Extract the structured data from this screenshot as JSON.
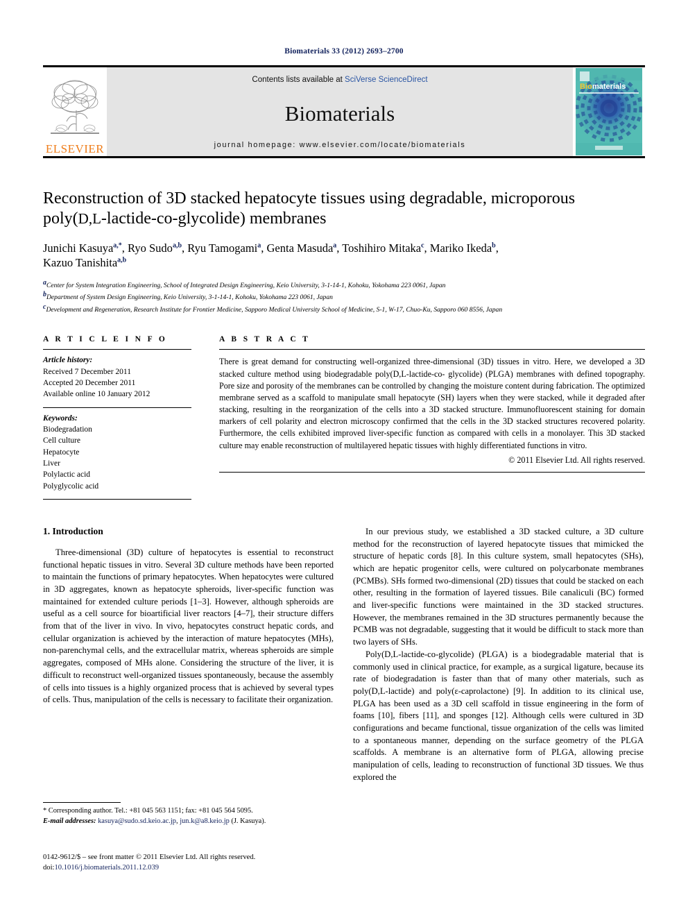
{
  "running_head": "Biomaterials 33 (2012) 2693–2700",
  "masthead": {
    "publisher_wordmark": "ELSEVIER",
    "contents_prefix": "Contents lists available at ",
    "contents_link": "SciVerse ScienceDirect",
    "journal_title": "Biomaterials",
    "homepage": "journal homepage: www.elsevier.com/locate/biomaterials",
    "cover_word_bio": "Bio",
    "cover_word_materials": "materials"
  },
  "article": {
    "title_line1": "Reconstruction of 3D stacked hepatocyte tissues using degradable, microporous",
    "title_line2_pre": "poly(",
    "title_line2_sc": "D,L",
    "title_line2_post": "-lactide-co-glycolide) membranes",
    "authors": [
      {
        "name": "Junichi Kasuya",
        "sup": "a,*"
      },
      {
        "name": "Ryo Sudo",
        "sup": "a,b"
      },
      {
        "name": "Ryu Tamogami",
        "sup": "a"
      },
      {
        "name": "Genta Masuda",
        "sup": "a"
      },
      {
        "name": "Toshihiro Mitaka",
        "sup": "c"
      },
      {
        "name": "Mariko Ikeda",
        "sup": "b"
      },
      {
        "name": "Kazuo Tanishita",
        "sup": "a,b"
      }
    ],
    "affiliations": [
      {
        "mark": "a",
        "text": "Center for System Integration Engineering, School of Integrated Design Engineering, Keio University, 3-1-14-1, Kohoku, Yokohama 223 0061, Japan"
      },
      {
        "mark": "b",
        "text": "Department of System Design Engineering, Keio University, 3-1-14-1, Kohoku, Yokohama 223 0061, Japan"
      },
      {
        "mark": "c",
        "text": "Development and Regeneration, Research Institute for Frontier Medicine, Sapporo Medical University School of Medicine, S-1, W-17, Chuo-Ku, Sapporo 060 8556, Japan"
      }
    ]
  },
  "article_info": {
    "heading": "A R T I C L E   I N F O",
    "history_label": "Article history:",
    "history": [
      "Received 7 December 2011",
      "Accepted 20 December 2011",
      "Available online 10 January 2012"
    ],
    "keywords_label": "Keywords:",
    "keywords": [
      "Biodegradation",
      "Cell culture",
      "Hepatocyte",
      "Liver",
      "Polylactic acid",
      "Polyglycolic acid"
    ]
  },
  "abstract": {
    "heading": "A B S T R A C T",
    "text": "There is great demand for constructing well-organized three-dimensional (3D) tissues in vitro. Here, we developed a 3D stacked culture method using biodegradable poly(D,L-lactide-co- glycolide) (PLGA) membranes with defined topography. Pore size and porosity of the membranes can be controlled by changing the moisture content during fabrication. The optimized membrane served as a scaffold to manipulate small hepatocyte (SH) layers when they were stacked, while it degraded after stacking, resulting in the reorganization of the cells into a 3D stacked structure. Immunofluorescent staining for domain markers of cell polarity and electron microscopy confirmed that the cells in the 3D stacked structures recovered polarity. Furthermore, the cells exhibited improved liver-specific function as compared with cells in a monolayer. This 3D stacked culture may enable reconstruction of multilayered hepatic tissues with highly differentiated functions in vitro.",
    "copyright": "© 2011 Elsevier Ltd. All rights reserved."
  },
  "body": {
    "section_title": "1. Introduction",
    "left_paragraphs": [
      "Three-dimensional (3D) culture of hepatocytes is essential to reconstruct functional hepatic tissues in vitro. Several 3D culture methods have been reported to maintain the functions of primary hepatocytes. When hepatocytes were cultured in 3D aggregates, known as hepatocyte spheroids, liver-specific function was maintained for extended culture periods [1–3]. However, although spheroids are useful as a cell source for bioartificial liver reactors [4–7], their structure differs from that of the liver in vivo. In vivo, hepatocytes construct hepatic cords, and cellular organization is achieved by the interaction of mature hepatocytes (MHs), non-parenchymal cells, and the extracellular matrix, whereas spheroids are simple aggregates, composed of MHs alone. Considering the structure of the liver, it is difficult to reconstruct well-organized tissues spontaneously, because the assembly of cells into tissues is a highly organized process that is achieved by several types of cells. Thus, manipulation of the cells is necessary to facilitate their organization."
    ],
    "right_paragraphs": [
      "In our previous study, we established a 3D stacked culture, a 3D culture method for the reconstruction of layered hepatocyte tissues that mimicked the structure of hepatic cords [8]. In this culture system, small hepatocytes (SHs), which are hepatic progenitor cells, were cultured on polycarbonate membranes (PCMBs). SHs formed two-dimensional (2D) tissues that could be stacked on each other, resulting in the formation of layered tissues. Bile canaliculi (BC) formed and liver-specific functions were maintained in the 3D stacked structures. However, the membranes remained in the 3D structures permanently because the PCMB was not degradable, suggesting that it would be difficult to stack more than two layers of SHs.",
      "Poly(D,L-lactide-co-glycolide) (PLGA) is a biodegradable material that is commonly used in clinical practice, for example, as a surgical ligature, because its rate of biodegradation is faster than that of many other materials, such as poly(D,L-lactide) and poly(ε-caprolactone) [9]. In addition to its clinical use, PLGA has been used as a 3D cell scaffold in tissue engineering in the form of foams [10], fibers [11], and sponges [12]. Although cells were cultured in 3D configurations and became functional, tissue organization of the cells was limited to a spontaneous manner, depending on the surface geometry of the PLGA scaffolds. A membrane is an alternative form of PLGA, allowing precise manipulation of cells, leading to reconstruction of functional 3D tissues. We thus explored the"
    ]
  },
  "footnotes": {
    "corresponding": "* Corresponding author. Tel.: +81 045 563 1151; fax: +81 045 564 5095.",
    "email_label": "E-mail addresses:",
    "email1": "kasuya@sudo.sd.keio.ac.jp",
    "email2": "jun.k@a8.keio.jp",
    "email_suffix": "(J. Kasuya)."
  },
  "imprint": {
    "line1": "0142-9612/$ – see front matter © 2011 Elsevier Ltd. All rights reserved.",
    "doi_label": "doi:",
    "doi_value": "10.1016/j.biomaterials.2011.12.039"
  },
  "colors": {
    "link": "#11215c",
    "sciencedirect_link": "#2a55a3",
    "elsevier_orange": "#ef7d1a",
    "masthead_grey": "#e4e4e4",
    "cover_teal": "#4fb3ab",
    "cover_blue": "#1e3a8a"
  }
}
